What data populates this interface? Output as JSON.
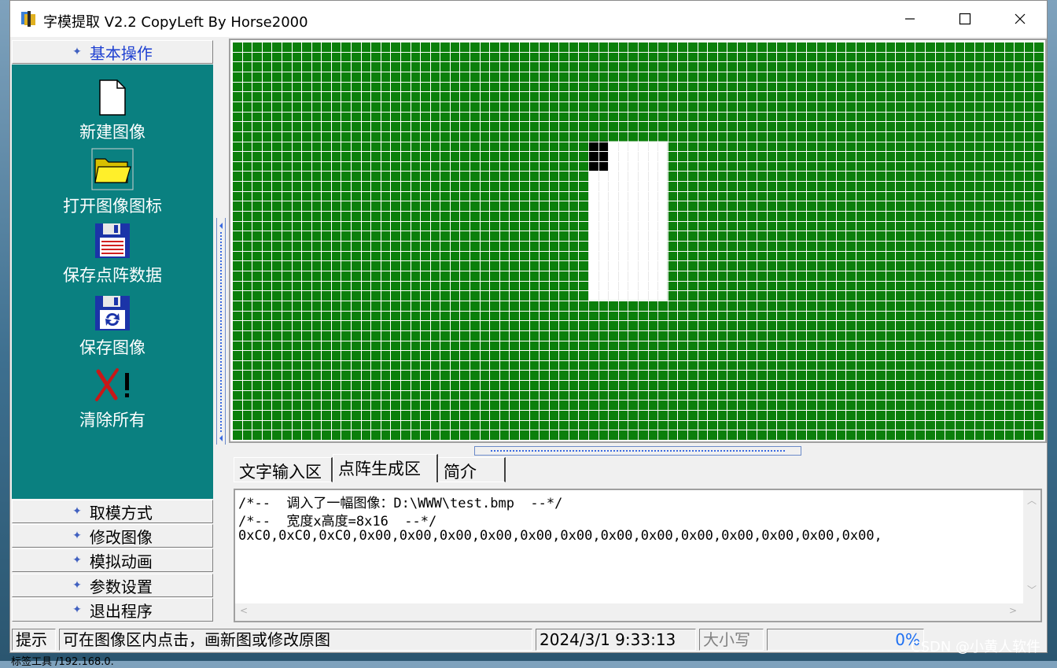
{
  "window": {
    "title": "字模提取 V2.2  CopyLeft By Horse2000",
    "minimize_icon": "minimize-icon",
    "maximize_icon": "maximize-icon",
    "close_icon": "close-icon"
  },
  "sidebar": {
    "active_section": "基本操作",
    "tools": [
      {
        "label": "新建图像",
        "icon": "new-file-icon"
      },
      {
        "label": "打开图像图标",
        "icon": "open-folder-icon"
      },
      {
        "label": "保存点阵数据",
        "icon": "save-data-floppy-icon"
      },
      {
        "label": "保存图像",
        "icon": "save-image-floppy-icon"
      },
      {
        "label": "清除所有",
        "icon": "clear-all-icon"
      }
    ],
    "sections": [
      "取模方式",
      "修改图像",
      "模拟动画",
      "参数设置",
      "退出程序"
    ]
  },
  "canvas": {
    "cols": 82,
    "rows": 40,
    "background_color": "#0b7f0b",
    "grid_color": "#ffffff",
    "white_region": {
      "col": 36,
      "row": 10,
      "width": 8,
      "height": 16
    },
    "black_pixels": [
      [
        0,
        0
      ],
      [
        1,
        0
      ],
      [
        0,
        1
      ],
      [
        1,
        1
      ],
      [
        0,
        2
      ],
      [
        1,
        2
      ]
    ]
  },
  "tabs": [
    {
      "label": "文字输入区",
      "active": false
    },
    {
      "label": "点阵生成区",
      "active": true
    },
    {
      "label": "简介",
      "active": false
    }
  ],
  "output": {
    "lines": [
      "/*--  调入了一幅图像：D:\\WWW\\test.bmp  --*/",
      "/*--  宽度x高度=8x16  --*/",
      "0xC0,0xC0,0xC0,0x00,0x00,0x00,0x00,0x00,0x00,0x00,0x00,0x00,0x00,0x00,0x00,0x00,"
    ]
  },
  "statusbar": {
    "hint_label": "提示",
    "hint_text": "可在图像区内点击，画新图或修改原图",
    "datetime": "2024/3/1 9:33:13",
    "caps": "大小写",
    "progress": "0%"
  },
  "watermark": "CSDN @小黄人软件",
  "background_text": "标签工具      /192.168.0."
}
